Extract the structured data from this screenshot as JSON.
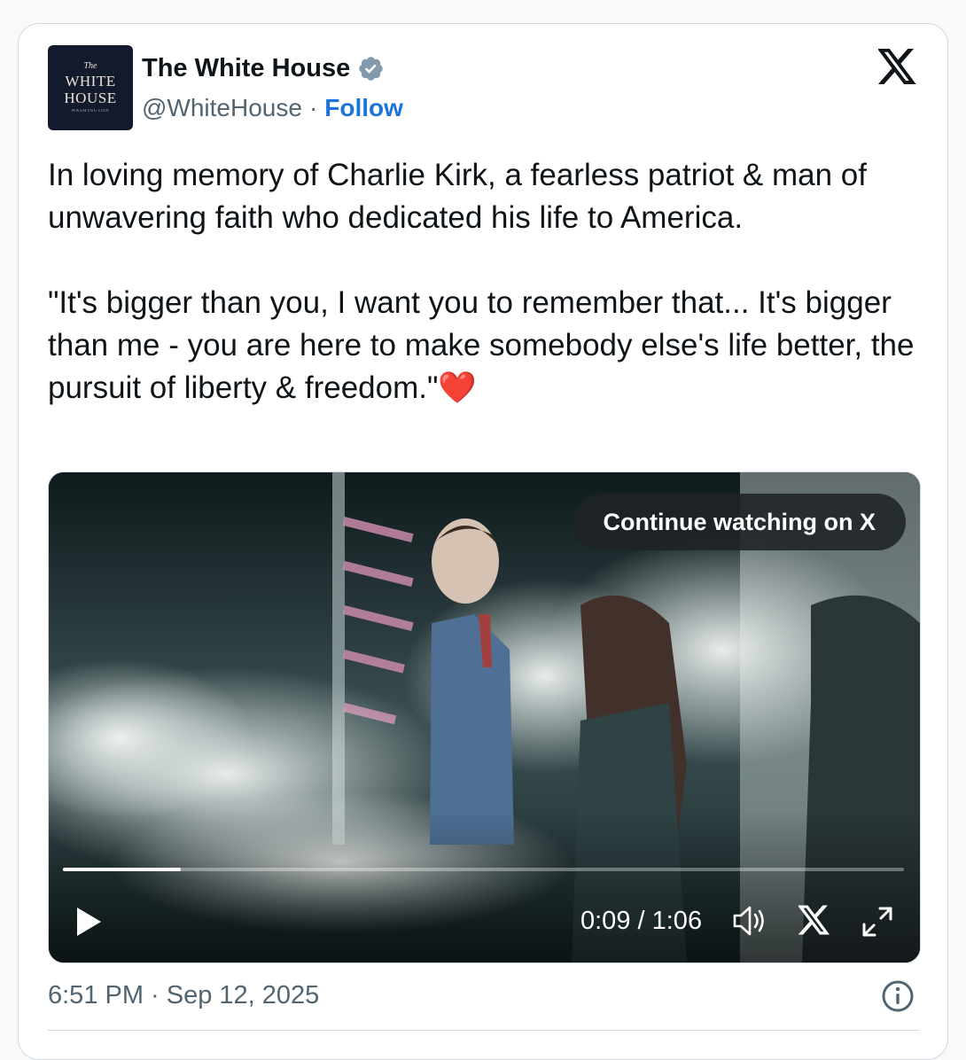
{
  "account": {
    "avatar_line1": "The",
    "avatar_line2": "WHITE",
    "avatar_line3": "HOUSE",
    "avatar_line4": "WASHINGTON",
    "name": "The White House",
    "handle": "@WhiteHouse",
    "separator": "·",
    "follow_label": "Follow",
    "verified_icon": "verified-badge-icon"
  },
  "tweet": {
    "text": "In loving memory of Charlie Kirk, a fearless patriot & man of unwavering faith who dedicated his life to America.\n\n\"It's bigger than you, I want you to remember that... It's bigger than me - you are here to make somebody else's life better, the pursuit of liberty & freedom.\"",
    "emoji": "❤️"
  },
  "video": {
    "continue_label": "Continue watching on X",
    "current_time": "0:09",
    "time_separator": " / ",
    "duration": "1:06",
    "progress_fraction": 0.14
  },
  "footer": {
    "timestamp": "6:51 PM · Sep 12, 2025"
  },
  "colors": {
    "follow": "#1d74d9",
    "secondary_text": "#536471",
    "verified": "#829aab",
    "heart": "#e0323c"
  }
}
